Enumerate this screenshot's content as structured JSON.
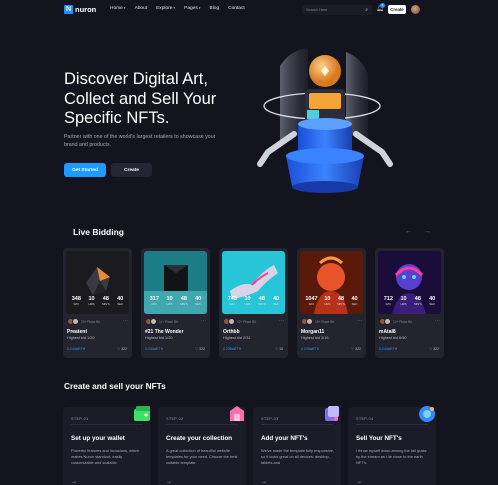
{
  "header": {
    "logo_letter": "N",
    "logo_text": "nuron",
    "nav": [
      {
        "label": "Home",
        "caret": true
      },
      {
        "label": "About",
        "caret": false
      },
      {
        "label": "Explore",
        "caret": true
      },
      {
        "label": "Pages",
        "caret": true
      },
      {
        "label": "Blog",
        "caret": false
      },
      {
        "label": "Contact",
        "caret": false
      }
    ],
    "search_placeholder": "Search Here",
    "notification_count": "6",
    "create_label": "Create"
  },
  "hero": {
    "title": "Discover Digital Art, Collect and Sell Your Specific NFTs.",
    "subtitle": "Partner with one of the world's largest retailers to showcase your brand and products.",
    "btn_start": "Get Started",
    "btn_create": "Create"
  },
  "live_bidding": {
    "title": "Live Bidding",
    "prev": "←",
    "next": "→",
    "units": {
      "day": "DAY",
      "hrs": "HRS",
      "mins": "MIN'S",
      "sec": "SEC"
    },
    "cards": [
      {
        "day": "348",
        "hrs": "10",
        "mins": "48",
        "sec": "40",
        "people": "20+ Place Bit.",
        "name": "Preatent",
        "bid": "Highest bid 1/20",
        "price": "0.244wETH",
        "likes": "322",
        "theme": "dark"
      },
      {
        "day": "317",
        "hrs": "10",
        "mins": "48",
        "sec": "40",
        "people": "11+ Place Bit.",
        "name": "#21 The Wonder",
        "bid": "Highest bid 1/20",
        "price": "0.244wETH",
        "likes": "322",
        "theme": "teal"
      },
      {
        "day": "743",
        "hrs": "10",
        "mins": "48",
        "sec": "40",
        "people": "12+ Place Bit.",
        "name": "Orthbb",
        "bid": "Highest bid 2/31",
        "price": "0.235wETH",
        "likes": "15",
        "theme": "cyan"
      },
      {
        "day": "1047",
        "hrs": "10",
        "mins": "48",
        "sec": "40",
        "people": "15+ Place Bit.",
        "name": "Morgan11",
        "bid": "Highest bid 3/16",
        "price": "0.244wETH",
        "likes": "322",
        "theme": "orange"
      },
      {
        "day": "712",
        "hrs": "10",
        "mins": "48",
        "sec": "40",
        "people": "10+ Place Bit.",
        "name": "mAtal8",
        "bid": "Highest bid 6/50",
        "price": "0.244wETH",
        "likes": "322",
        "theme": "purple"
      }
    ]
  },
  "create_sell": {
    "title": "Create and sell your NFTs",
    "steps": [
      {
        "no": "STEP-01",
        "title": "Set up your wallet",
        "desc": "Powerful features and inclusions, which makes Nuron standout, easily customizable and scalable.",
        "icon": "wallet-icon"
      },
      {
        "no": "STEP-02",
        "title": "Create your collection",
        "desc": "A great collection of beautiful website templates for your need. Choose the best suitable template.",
        "icon": "collection-icon"
      },
      {
        "no": "STEP-03",
        "title": "Add your NFT's",
        "desc": "We've made the template fully responsive, so it looks great on all devices: desktop, tablets and",
        "icon": "add-nft-icon"
      },
      {
        "no": "STEP-04",
        "title": "Sell Your NFT's",
        "desc": "I throw myself down among the tall grass by the stream as I lie close to the earth NFT's.",
        "icon": "sell-icon"
      }
    ],
    "arrow": "→"
  }
}
